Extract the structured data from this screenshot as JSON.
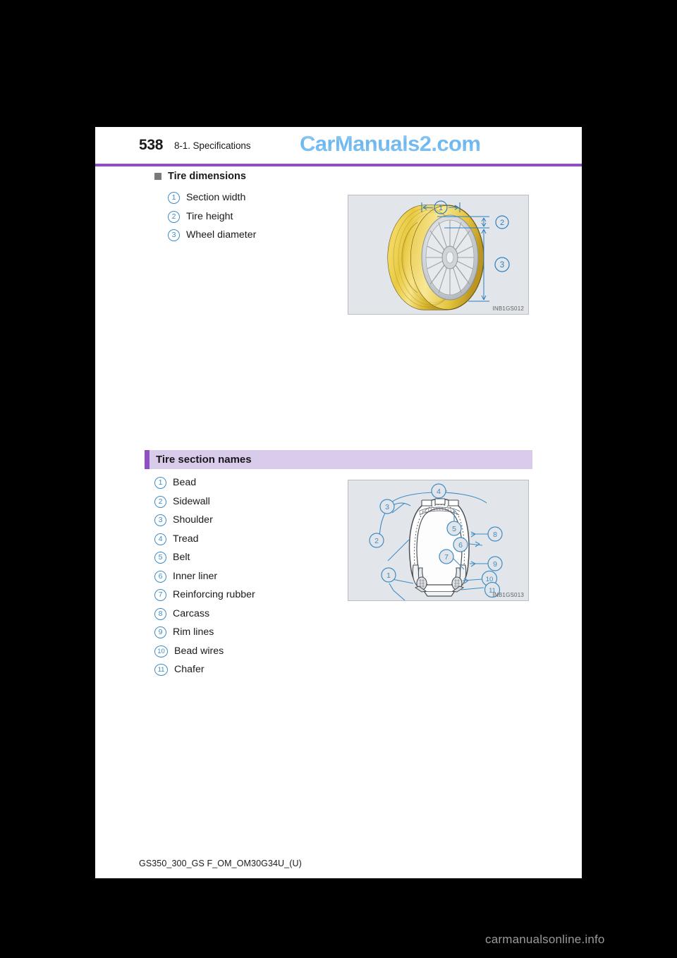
{
  "header": {
    "page_number": "538",
    "section": "8-1. Specifications",
    "watermark": "CarManuals2.com"
  },
  "tire_dimensions": {
    "heading": "Tire dimensions",
    "items": [
      {
        "num": "1",
        "label": "Section width"
      },
      {
        "num": "2",
        "label": "Tire height"
      },
      {
        "num": "3",
        "label": "Wheel diameter"
      }
    ],
    "figure_id": "INB1GS012",
    "figure_callouts": [
      "1",
      "2",
      "3"
    ]
  },
  "tire_section_names": {
    "band_title": "Tire section names",
    "items": [
      {
        "num": "1",
        "label": "Bead"
      },
      {
        "num": "2",
        "label": "Sidewall"
      },
      {
        "num": "3",
        "label": "Shoulder"
      },
      {
        "num": "4",
        "label": "Tread"
      },
      {
        "num": "5",
        "label": "Belt"
      },
      {
        "num": "6",
        "label": "Inner liner"
      },
      {
        "num": "7",
        "label": "Reinforcing rubber"
      },
      {
        "num": "8",
        "label": "Carcass"
      },
      {
        "num": "9",
        "label": "Rim lines"
      },
      {
        "num": "10",
        "label": "Bead wires"
      },
      {
        "num": "11",
        "label": "Chafer"
      }
    ],
    "figure_id": "INB1GS013",
    "figure_callouts": [
      "1",
      "2",
      "3",
      "4",
      "5",
      "6",
      "7",
      "8",
      "9",
      "10",
      "11"
    ]
  },
  "footer": {
    "document_code": "GS350_300_GS F_OM_OM30G34U_(U)"
  },
  "bottom_brand": "carmanualsonline.info",
  "colors": {
    "accent_purple": "#8e4fc4",
    "band_fill": "#d9cbea",
    "callout_blue": "#3e8cc4",
    "figure_bg": "#e2e5ea",
    "watermark_blue": "#7ec0f0"
  }
}
